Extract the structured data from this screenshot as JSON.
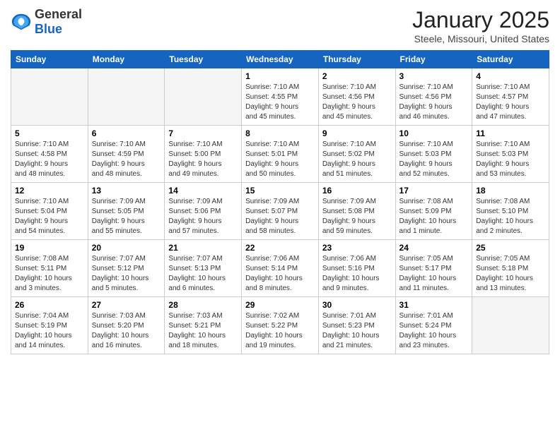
{
  "header": {
    "logo_general": "General",
    "logo_blue": "Blue",
    "month": "January 2025",
    "location": "Steele, Missouri, United States"
  },
  "days_of_week": [
    "Sunday",
    "Monday",
    "Tuesday",
    "Wednesday",
    "Thursday",
    "Friday",
    "Saturday"
  ],
  "weeks": [
    [
      {
        "day": "",
        "info": ""
      },
      {
        "day": "",
        "info": ""
      },
      {
        "day": "",
        "info": ""
      },
      {
        "day": "1",
        "info": "Sunrise: 7:10 AM\nSunset: 4:55 PM\nDaylight: 9 hours\nand 45 minutes."
      },
      {
        "day": "2",
        "info": "Sunrise: 7:10 AM\nSunset: 4:56 PM\nDaylight: 9 hours\nand 45 minutes."
      },
      {
        "day": "3",
        "info": "Sunrise: 7:10 AM\nSunset: 4:56 PM\nDaylight: 9 hours\nand 46 minutes."
      },
      {
        "day": "4",
        "info": "Sunrise: 7:10 AM\nSunset: 4:57 PM\nDaylight: 9 hours\nand 47 minutes."
      }
    ],
    [
      {
        "day": "5",
        "info": "Sunrise: 7:10 AM\nSunset: 4:58 PM\nDaylight: 9 hours\nand 48 minutes."
      },
      {
        "day": "6",
        "info": "Sunrise: 7:10 AM\nSunset: 4:59 PM\nDaylight: 9 hours\nand 48 minutes."
      },
      {
        "day": "7",
        "info": "Sunrise: 7:10 AM\nSunset: 5:00 PM\nDaylight: 9 hours\nand 49 minutes."
      },
      {
        "day": "8",
        "info": "Sunrise: 7:10 AM\nSunset: 5:01 PM\nDaylight: 9 hours\nand 50 minutes."
      },
      {
        "day": "9",
        "info": "Sunrise: 7:10 AM\nSunset: 5:02 PM\nDaylight: 9 hours\nand 51 minutes."
      },
      {
        "day": "10",
        "info": "Sunrise: 7:10 AM\nSunset: 5:03 PM\nDaylight: 9 hours\nand 52 minutes."
      },
      {
        "day": "11",
        "info": "Sunrise: 7:10 AM\nSunset: 5:03 PM\nDaylight: 9 hours\nand 53 minutes."
      }
    ],
    [
      {
        "day": "12",
        "info": "Sunrise: 7:10 AM\nSunset: 5:04 PM\nDaylight: 9 hours\nand 54 minutes."
      },
      {
        "day": "13",
        "info": "Sunrise: 7:09 AM\nSunset: 5:05 PM\nDaylight: 9 hours\nand 55 minutes."
      },
      {
        "day": "14",
        "info": "Sunrise: 7:09 AM\nSunset: 5:06 PM\nDaylight: 9 hours\nand 57 minutes."
      },
      {
        "day": "15",
        "info": "Sunrise: 7:09 AM\nSunset: 5:07 PM\nDaylight: 9 hours\nand 58 minutes."
      },
      {
        "day": "16",
        "info": "Sunrise: 7:09 AM\nSunset: 5:08 PM\nDaylight: 9 hours\nand 59 minutes."
      },
      {
        "day": "17",
        "info": "Sunrise: 7:08 AM\nSunset: 5:09 PM\nDaylight: 10 hours\nand 1 minute."
      },
      {
        "day": "18",
        "info": "Sunrise: 7:08 AM\nSunset: 5:10 PM\nDaylight: 10 hours\nand 2 minutes."
      }
    ],
    [
      {
        "day": "19",
        "info": "Sunrise: 7:08 AM\nSunset: 5:11 PM\nDaylight: 10 hours\nand 3 minutes."
      },
      {
        "day": "20",
        "info": "Sunrise: 7:07 AM\nSunset: 5:12 PM\nDaylight: 10 hours\nand 5 minutes."
      },
      {
        "day": "21",
        "info": "Sunrise: 7:07 AM\nSunset: 5:13 PM\nDaylight: 10 hours\nand 6 minutes."
      },
      {
        "day": "22",
        "info": "Sunrise: 7:06 AM\nSunset: 5:14 PM\nDaylight: 10 hours\nand 8 minutes."
      },
      {
        "day": "23",
        "info": "Sunrise: 7:06 AM\nSunset: 5:16 PM\nDaylight: 10 hours\nand 9 minutes."
      },
      {
        "day": "24",
        "info": "Sunrise: 7:05 AM\nSunset: 5:17 PM\nDaylight: 10 hours\nand 11 minutes."
      },
      {
        "day": "25",
        "info": "Sunrise: 7:05 AM\nSunset: 5:18 PM\nDaylight: 10 hours\nand 13 minutes."
      }
    ],
    [
      {
        "day": "26",
        "info": "Sunrise: 7:04 AM\nSunset: 5:19 PM\nDaylight: 10 hours\nand 14 minutes."
      },
      {
        "day": "27",
        "info": "Sunrise: 7:03 AM\nSunset: 5:20 PM\nDaylight: 10 hours\nand 16 minutes."
      },
      {
        "day": "28",
        "info": "Sunrise: 7:03 AM\nSunset: 5:21 PM\nDaylight: 10 hours\nand 18 minutes."
      },
      {
        "day": "29",
        "info": "Sunrise: 7:02 AM\nSunset: 5:22 PM\nDaylight: 10 hours\nand 19 minutes."
      },
      {
        "day": "30",
        "info": "Sunrise: 7:01 AM\nSunset: 5:23 PM\nDaylight: 10 hours\nand 21 minutes."
      },
      {
        "day": "31",
        "info": "Sunrise: 7:01 AM\nSunset: 5:24 PM\nDaylight: 10 hours\nand 23 minutes."
      },
      {
        "day": "",
        "info": ""
      }
    ]
  ]
}
